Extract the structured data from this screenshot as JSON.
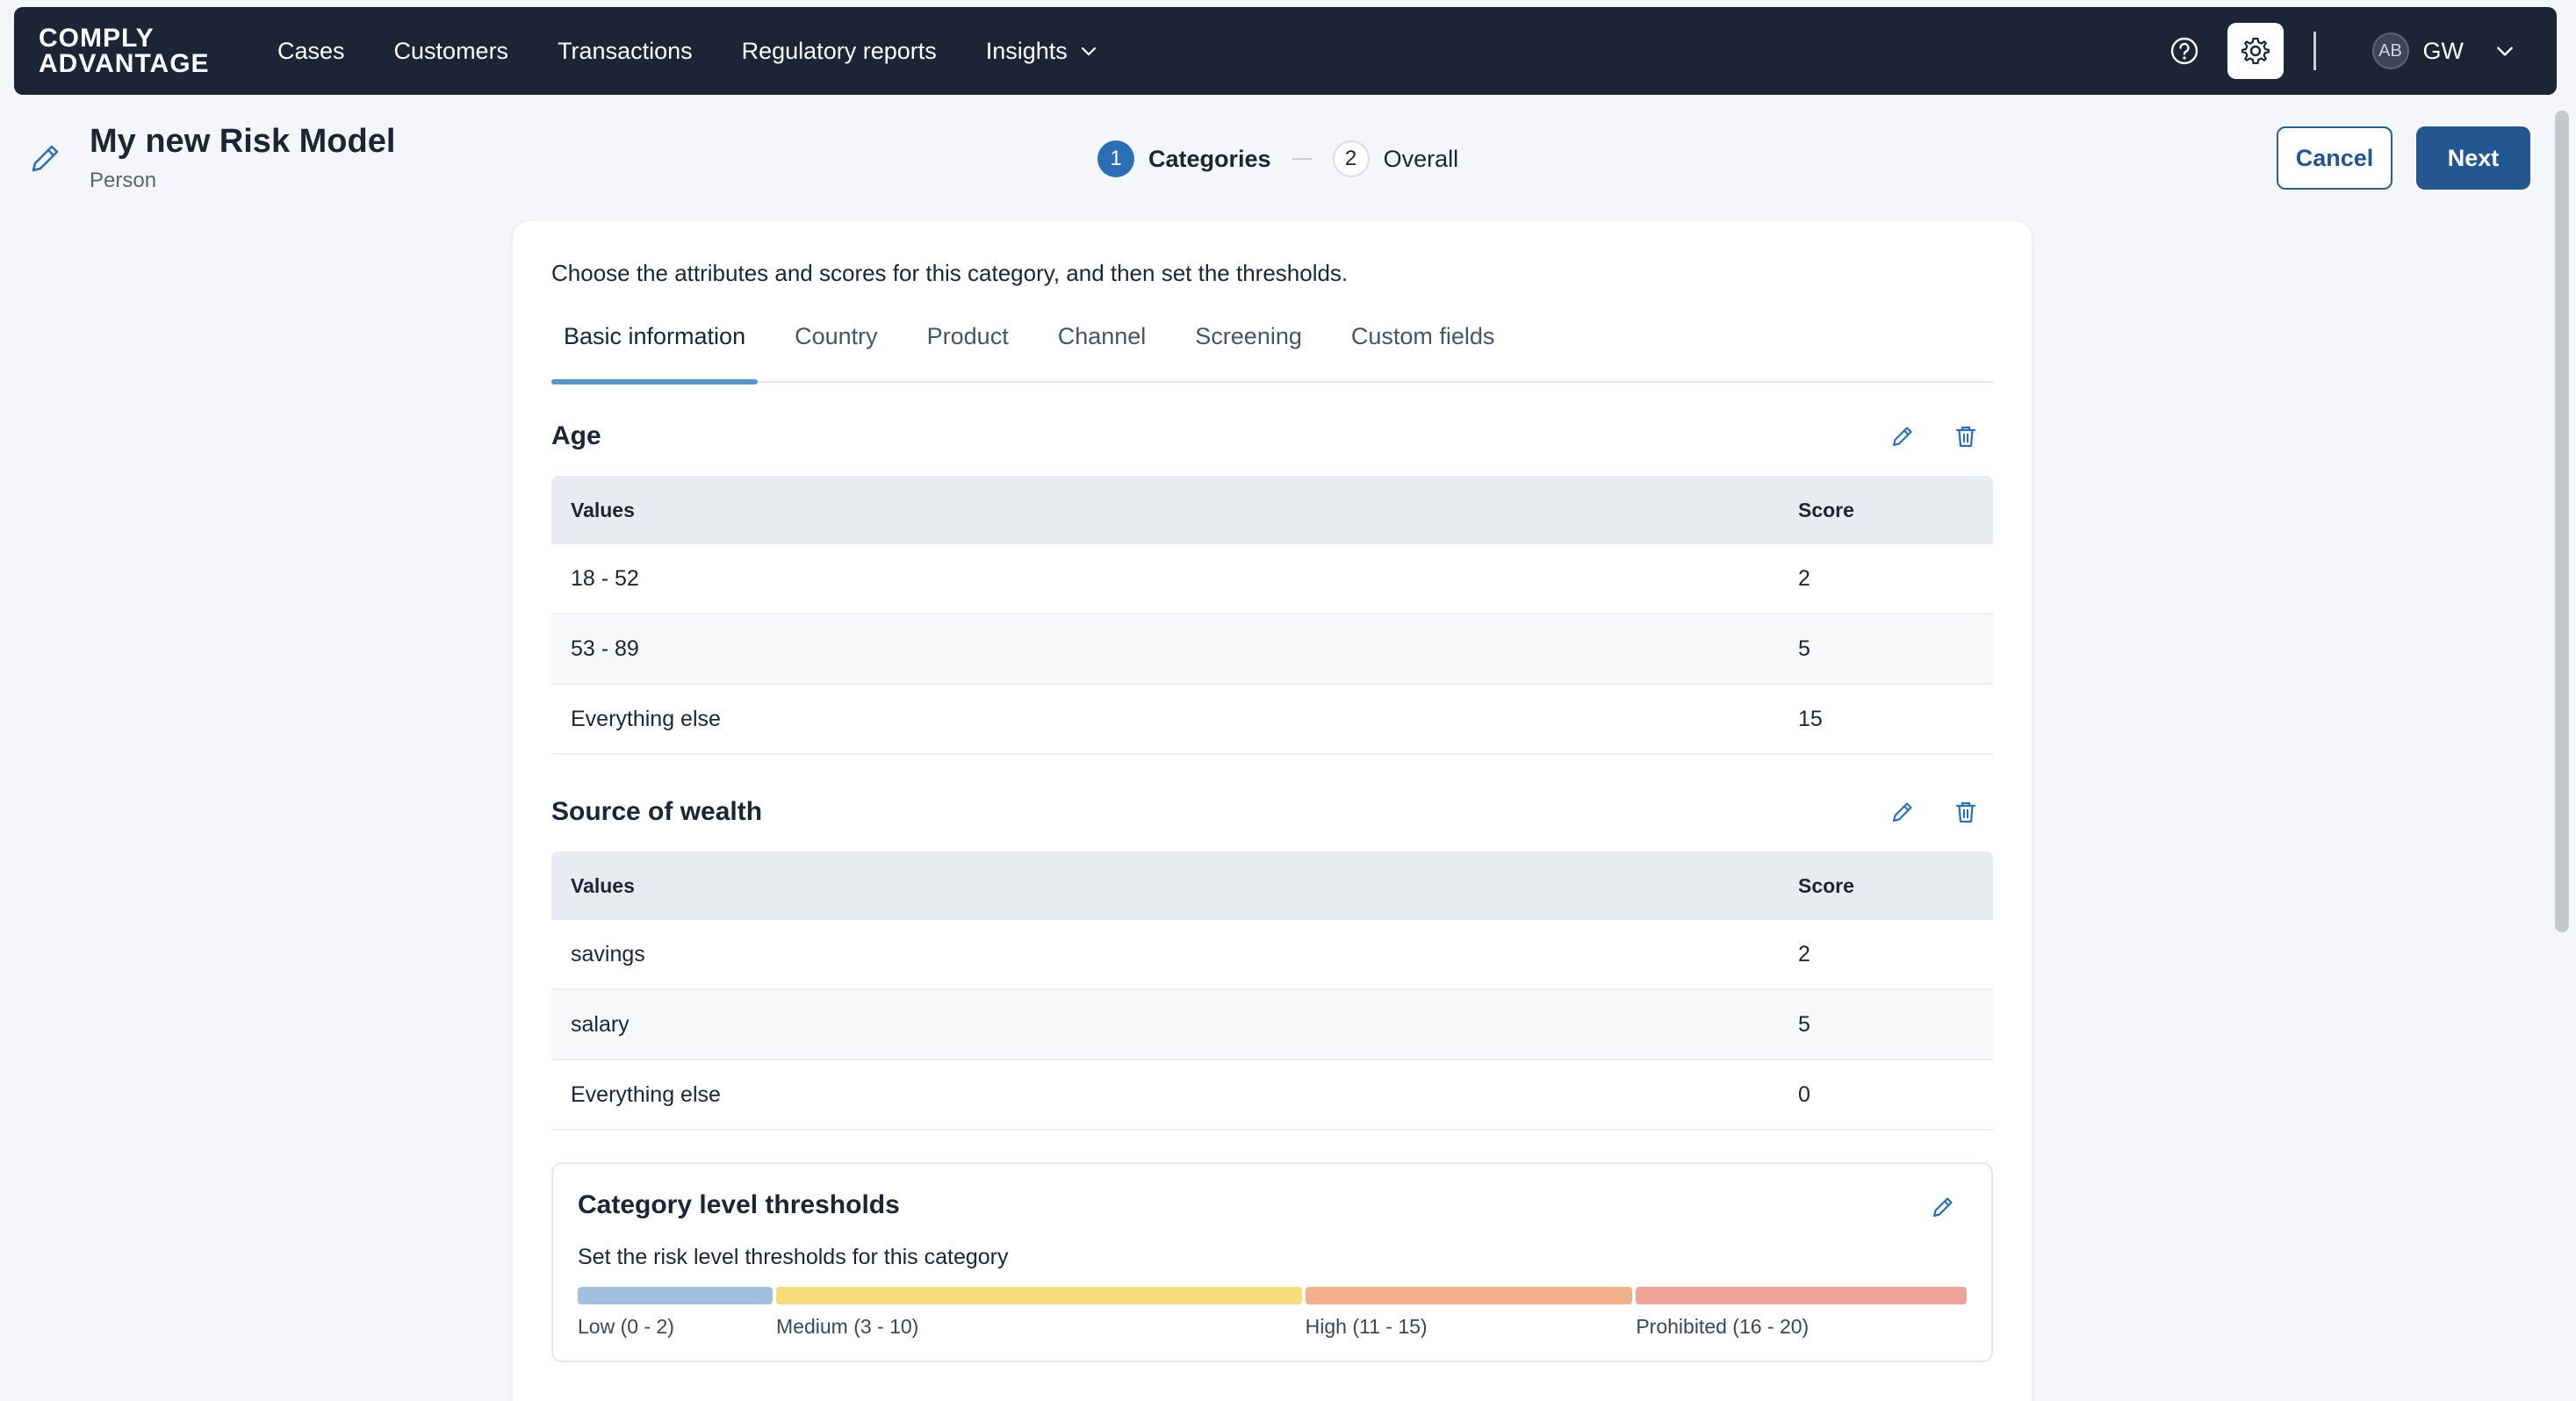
{
  "brand": {
    "line1": "COMPLY",
    "line2": "ADVANTAGE"
  },
  "nav": {
    "links": [
      "Cases",
      "Customers",
      "Transactions",
      "Regulatory reports",
      "Insights"
    ],
    "user_initials": "AB",
    "user_name": "GW"
  },
  "header": {
    "title": "My new Risk Model",
    "subtitle": "Person",
    "steps": [
      {
        "number": "1",
        "label": "Categories",
        "active": true
      },
      {
        "number": "2",
        "label": "Overall",
        "active": false
      }
    ],
    "cancel_label": "Cancel",
    "next_label": "Next"
  },
  "card": {
    "intro": "Choose the attributes and scores for this category, and then set the thresholds.",
    "tabs": [
      "Basic information",
      "Country",
      "Product",
      "Channel",
      "Screening",
      "Custom fields"
    ],
    "active_tab": "Basic information",
    "sections": [
      {
        "title": "Age",
        "headers": {
          "values": "Values",
          "score": "Score"
        },
        "rows": [
          {
            "value": "18 - 52",
            "score": "2"
          },
          {
            "value": "53 - 89",
            "score": "5"
          },
          {
            "value": "Everything else",
            "score": "15"
          }
        ]
      },
      {
        "title": "Source of wealth",
        "headers": {
          "values": "Values",
          "score": "Score"
        },
        "rows": [
          {
            "value": "savings",
            "score": "2"
          },
          {
            "value": "salary",
            "score": "5"
          },
          {
            "value": "Everything else",
            "score": "0"
          }
        ]
      }
    ],
    "thresholds": {
      "title": "Category level thresholds",
      "description": "Set the risk level thresholds for this category",
      "max_score": 20,
      "levels": [
        {
          "label": "Low (0 - 2)",
          "min": 0,
          "max": 2,
          "color": "#9fc0df"
        },
        {
          "label": "Medium (3 - 10)",
          "min": 3,
          "max": 10,
          "color": "#f7dc7c"
        },
        {
          "label": "High (11 - 15)",
          "min": 11,
          "max": 15,
          "color": "#f2b08d"
        },
        {
          "label": "Prohibited (16 - 20)",
          "min": 16,
          "max": 20,
          "color": "#f0a497"
        }
      ]
    }
  }
}
